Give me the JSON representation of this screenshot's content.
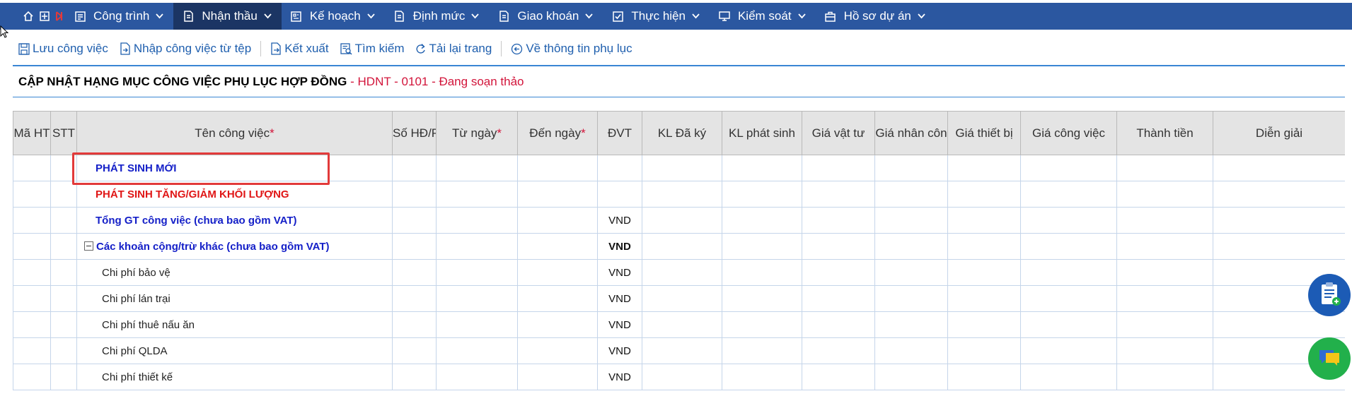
{
  "nav": {
    "items": [
      {
        "label": "Công trình",
        "icon": "building-icon"
      },
      {
        "label": "Nhận thầu",
        "icon": "document-icon",
        "active": true
      },
      {
        "label": "Kế hoạch",
        "icon": "plan-icon"
      },
      {
        "label": "Định mức",
        "icon": "norm-icon"
      },
      {
        "label": "Giao khoán",
        "icon": "contract-icon"
      },
      {
        "label": "Thực hiện",
        "icon": "checkbox-icon"
      },
      {
        "label": "Kiểm soát",
        "icon": "monitor-icon"
      },
      {
        "label": "Hồ sơ dự án",
        "icon": "briefcase-icon"
      }
    ],
    "bar_color": "#2b57a0",
    "active_color": "#1b3564"
  },
  "toolbar": {
    "save": "Lưu công việc",
    "import": "Nhập công việc từ tệp",
    "export": "Kết xuất",
    "search": "Tìm kiếm",
    "reload": "Tải lại trang",
    "back": "Về thông tin phụ lục"
  },
  "page": {
    "title": "CẬP NHẬT HẠNG MỤC CÔNG VIỆC PHỤ LỤC HỢP ĐỒNG",
    "subtitle": " - HDNT - 0101 - Đang soạn thảo"
  },
  "table": {
    "headers": {
      "ma_ht": "Mã HT",
      "stt": "STT",
      "ten_cong_viec": "Tên công việc",
      "so_hd": "Số HĐ/P",
      "tu_ngay": "Từ ngày",
      "den_ngay": "Đến ngày",
      "dvt": "ĐVT",
      "kl_da_ky": "KL Đã ký",
      "kl_phat_sinh": "KL phát sinh",
      "gia_vat_tu": "Giá vật tư",
      "gia_nhan_cong": "Giá nhân côn",
      "gia_thiet_bi": "Giá thiết bị",
      "gia_cong_viec": "Giá công việc",
      "thanh_tien": "Thành tiền",
      "dien_giai": "Diễn giải"
    },
    "required_mark": "*",
    "rows": [
      {
        "name": "PHÁT SINH MỚI",
        "dvt": ""
      },
      {
        "name": "PHÁT SINH TĂNG/GIẢM KHỐI LƯỢNG",
        "dvt": ""
      },
      {
        "name": "Tổng GT công việc (chưa bao gồm VAT)",
        "dvt": "VND"
      },
      {
        "name": "Các khoản cộng/trừ khác (chưa bao gồm VAT)",
        "dvt": "VND"
      },
      {
        "name": "Chi phí bảo vệ",
        "dvt": "VND"
      },
      {
        "name": "Chi phí lán trại",
        "dvt": "VND"
      },
      {
        "name": "Chi phí thuê nấu ăn",
        "dvt": "VND"
      },
      {
        "name": "Chi phí QLDA",
        "dvt": "VND"
      },
      {
        "name": "Chi phí thiết kế",
        "dvt": "VND"
      }
    ]
  }
}
